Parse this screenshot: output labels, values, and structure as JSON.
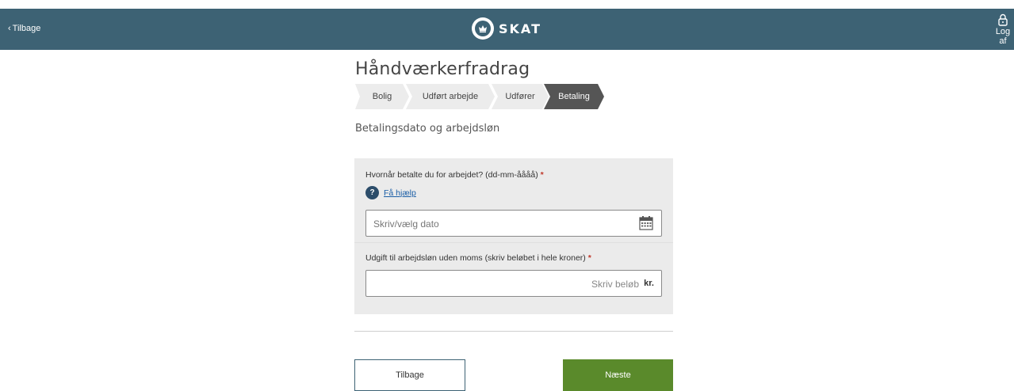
{
  "header": {
    "back_label": "Tilbage",
    "logo_text": "SKAT",
    "logout_label": "Log af",
    "bg_color": "#3d6274"
  },
  "page": {
    "title": "Håndværkerfradrag",
    "subtitle": "Betalingsdato og arbejdsløn"
  },
  "steps": [
    {
      "label": "Bolig",
      "active": false
    },
    {
      "label": "Udført arbejde",
      "active": false
    },
    {
      "label": "Udfører",
      "active": false
    },
    {
      "label": "Betaling",
      "active": true
    }
  ],
  "form": {
    "date_question": "Hvornår betalte du for arbejdet? (dd-mm-åååå)",
    "required_mark": "*",
    "help_icon_text": "?",
    "help_link": "Få hjælp",
    "date_placeholder": "Skriv/vælg dato",
    "amount_question": "Udgift til arbejdsløn uden moms (skriv beløbet i hele kroner)",
    "amount_placeholder": "Skriv beløb",
    "amount_unit": "kr."
  },
  "buttons": {
    "back": "Tilbage",
    "next": "Næste",
    "next_color": "#5a8a2b"
  },
  "icons": {
    "back": "chevron-left-icon",
    "logout": "lock-icon",
    "calendar": "calendar-icon",
    "help": "question-icon"
  }
}
